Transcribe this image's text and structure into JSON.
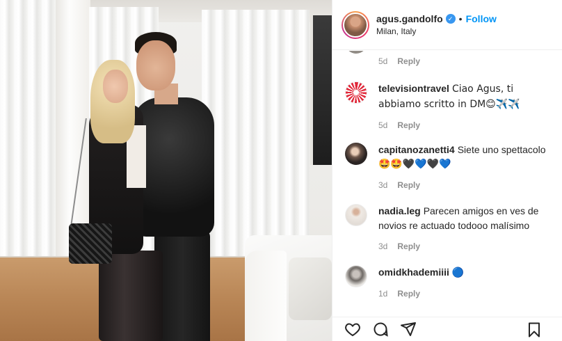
{
  "post": {
    "author": {
      "username": "agus.gandolfo",
      "verified_icon": "verified-badge-icon",
      "separator": "•",
      "follow_label": "Follow",
      "location": "Milan, Italy"
    },
    "first_comment_meta": {
      "time": "5d",
      "reply_label": "Reply"
    },
    "comments": [
      {
        "username": "televisiontravel",
        "text": "Ciao Agus, ti abbiamo scritto in DM😊✈️✈️",
        "time": "5d",
        "reply_label": "Reply"
      },
      {
        "username": "capitanozanetti4",
        "text": "Siete uno spettacolo",
        "emojis": "🤩🤩🖤💙🖤💙",
        "time": "3d",
        "reply_label": "Reply"
      },
      {
        "username": "nadia.leg",
        "text": "Parecen amigos en ves de novios re actuado todooo malísimo",
        "time": "3d",
        "reply_label": "Reply"
      },
      {
        "username": "omidkhademiiii",
        "text": "🔵",
        "time": "1d",
        "reply_label": "Reply"
      }
    ],
    "actions": [
      "heart-icon",
      "comment-icon",
      "share-icon",
      "bookmark-icon"
    ]
  },
  "colors": {
    "follow_blue": "#0095f6",
    "verified_blue": "#3897f0",
    "muted_text": "#8e8e8e"
  }
}
